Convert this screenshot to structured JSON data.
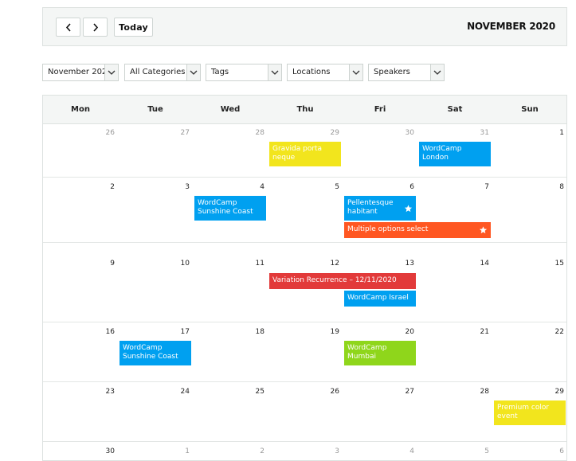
{
  "header": {
    "prev_icon": "‹",
    "next_icon": "›",
    "today_label": "Today",
    "month_title": "NOVEMBER 2020"
  },
  "filters": {
    "month_value": "November 202",
    "categories": "All Categories",
    "tags": "Tags",
    "locations": "Locations",
    "speakers": "Speakers"
  },
  "calendar": {
    "days_of_week": [
      "Mon",
      "Tue",
      "Wed",
      "Thu",
      "Fri",
      "Sat",
      "Sun"
    ],
    "weeks": [
      [
        "26",
        "27",
        "28",
        "29",
        "30",
        "31",
        "1"
      ],
      [
        "2",
        "3",
        "4",
        "5",
        "6",
        "7",
        "8"
      ],
      [
        "9",
        "10",
        "11",
        "12",
        "13",
        "14",
        "15"
      ],
      [
        "16",
        "17",
        "18",
        "19",
        "20",
        "21",
        "22"
      ],
      [
        "23",
        "24",
        "25",
        "26",
        "27",
        "28",
        "29"
      ],
      [
        "30",
        "1",
        "2",
        "3",
        "4",
        "5",
        "6"
      ]
    ],
    "events": [
      {
        "title": "Gravida porta neque",
        "color": "#f2e51d",
        "starred": false
      },
      {
        "title": "WordCamp London",
        "color": "#00a0f0",
        "starred": false
      },
      {
        "title": "WordCamp Sunshine Coast",
        "color": "#00a0f0",
        "starred": false
      },
      {
        "title": "Pellentesque habitant",
        "color": "#00a0f0",
        "starred": true
      },
      {
        "title": "Multiple options select",
        "color": "#ff5722",
        "starred": true
      },
      {
        "title": "Variation Recurrence – 12/11/2020",
        "color": "#e23a3a",
        "starred": false
      },
      {
        "title": "WordCamp Israel",
        "color": "#00a0f0",
        "starred": false
      },
      {
        "title": "WordCamp Sunshine Coast",
        "color": "#00a0f0",
        "starred": false
      },
      {
        "title": "WordCamp Mumbai",
        "color": "#8fd61b",
        "starred": false
      },
      {
        "title": "Premium color event",
        "color": "#f2e51d",
        "starred": false
      }
    ]
  }
}
